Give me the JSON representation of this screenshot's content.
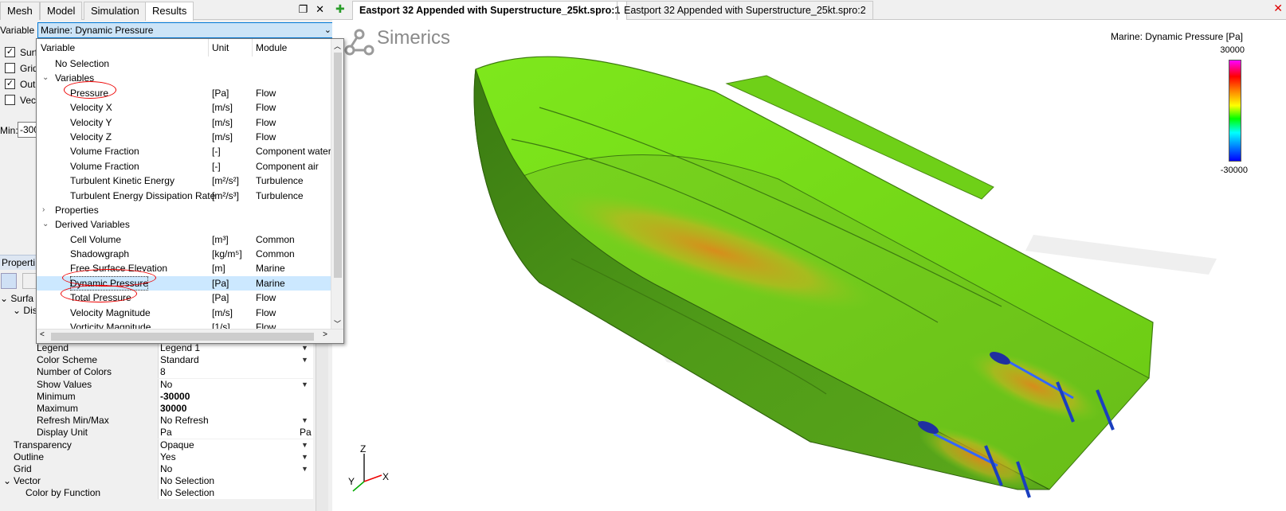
{
  "left_tabs": [
    "Mesh",
    "Model",
    "Simulation",
    "Results"
  ],
  "left_panel_icons": [
    "❐",
    "✕"
  ],
  "variable": {
    "label": "Variable",
    "value": "Marine: Dynamic Pressure"
  },
  "checkboxes": [
    {
      "label": "Surf",
      "checked": true
    },
    {
      "label": "Grid",
      "checked": false
    },
    {
      "label": "Out",
      "checked": true
    },
    {
      "label": "Vect",
      "checked": false
    }
  ],
  "min": {
    "label": "Min:",
    "value": "-300"
  },
  "properties_header": "Properti",
  "tree_top": [
    "Surfa",
    "Dis"
  ],
  "property_rows": [
    {
      "name": "Legend",
      "value": "Legend 1",
      "dropdown": true,
      "indent": 46
    },
    {
      "name": "Color Scheme",
      "value": "Standard",
      "dropdown": true,
      "indent": 46
    },
    {
      "name": "Number of Colors",
      "value": "8",
      "dropdown": false,
      "indent": 46
    },
    {
      "name": "Show Values",
      "value": "No",
      "dropdown": true,
      "indent": 46
    },
    {
      "name": "Minimum",
      "value": "-30000",
      "dropdown": false,
      "indent": 46,
      "bold": true
    },
    {
      "name": "Maximum",
      "value": "30000",
      "dropdown": false,
      "indent": 46,
      "bold": true
    },
    {
      "name": "Refresh Min/Max",
      "value": "No Refresh",
      "dropdown": true,
      "indent": 46
    },
    {
      "name": "Display Unit",
      "value": "Pa",
      "dropdown": false,
      "indent": 46,
      "suffix": "Pa"
    },
    {
      "name": "Transparency",
      "value": "Opaque",
      "dropdown": true,
      "indent": 17
    },
    {
      "name": "Outline",
      "value": "Yes",
      "dropdown": true,
      "indent": 17
    },
    {
      "name": "Grid",
      "value": "No",
      "dropdown": true,
      "indent": 17
    },
    {
      "name": "Vector",
      "value": "No Selection",
      "dropdown": false,
      "indent": 17,
      "expander": true
    },
    {
      "name": "Color by Function",
      "value": "No Selection",
      "dropdown": false,
      "indent": 32
    }
  ],
  "dropdown": {
    "headers": {
      "variable": "Variable",
      "unit": "Unit",
      "module": "Module"
    },
    "rows": [
      {
        "name": "No Selection",
        "unit": "",
        "module": "",
        "level": 1
      },
      {
        "name": "Variables",
        "unit": "",
        "module": "",
        "level": 1,
        "expander": "expanded"
      },
      {
        "name": "Pressure",
        "unit": "[Pa]",
        "module": "Flow",
        "level": 2
      },
      {
        "name": "Velocity X",
        "unit": "[m/s]",
        "module": "Flow",
        "level": 2
      },
      {
        "name": "Velocity Y",
        "unit": "[m/s]",
        "module": "Flow",
        "level": 2
      },
      {
        "name": "Velocity Z",
        "unit": "[m/s]",
        "module": "Flow",
        "level": 2
      },
      {
        "name": "Volume Fraction",
        "unit": "[-]",
        "module": "Component water",
        "level": 2
      },
      {
        "name": "Volume Fraction",
        "unit": "[-]",
        "module": "Component air",
        "level": 2
      },
      {
        "name": "Turbulent Kinetic Energy",
        "unit": "[m²/s²]",
        "module": "Turbulence",
        "level": 2
      },
      {
        "name": "Turbulent Energy Dissipation Rate",
        "unit": "[m²/s³]",
        "module": "Turbulence",
        "level": 2
      },
      {
        "name": "Properties",
        "unit": "",
        "module": "",
        "level": 1,
        "expander": "collapsed"
      },
      {
        "name": "Derived Variables",
        "unit": "",
        "module": "",
        "level": 1,
        "expander": "expanded"
      },
      {
        "name": "Cell Volume",
        "unit": "[m³]",
        "module": "Common",
        "level": 2
      },
      {
        "name": "Shadowgraph",
        "unit": "[kg/m⁵]",
        "module": "Common",
        "level": 2
      },
      {
        "name": "Free Surface Elevation",
        "unit": "[m]",
        "module": "Marine",
        "level": 2
      },
      {
        "name": "Dynamic Pressure",
        "unit": "[Pa]",
        "module": "Marine",
        "level": 2,
        "selected": true
      },
      {
        "name": "Total Pressure",
        "unit": "[Pa]",
        "module": "Flow",
        "level": 2
      },
      {
        "name": "Velocity Magnitude",
        "unit": "[m/s]",
        "module": "Flow",
        "level": 2
      },
      {
        "name": "Vorticity Magnitude",
        "unit": "[1/s]",
        "module": "Flow",
        "level": 2
      }
    ]
  },
  "view_tabs": [
    {
      "label": "Eastport 32 Appended with Superstructure_25kt.spro:1",
      "active": true
    },
    {
      "label": "Eastport 32 Appended with Superstructure_25kt.spro:2",
      "active": false
    }
  ],
  "add_tab_icon": "plus-icon",
  "logo": "Simerics",
  "legend": {
    "title": "Marine: Dynamic Pressure [Pa]",
    "max": "30000",
    "min": "-30000"
  },
  "axes": {
    "z": "Z",
    "x": "X",
    "y": "Y"
  },
  "colors": {
    "hull": "#7ed321",
    "selection": "#cce8ff",
    "highlight": "#e00000",
    "accent": "#0078d7"
  }
}
